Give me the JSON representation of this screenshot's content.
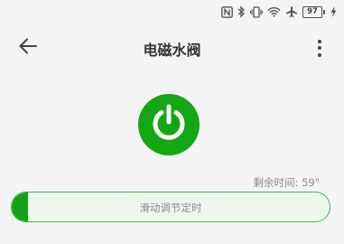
{
  "status_bar": {
    "battery_level": "97",
    "icons": [
      "nfc-icon",
      "bluetooth-icon",
      "vibrate-icon",
      "wifi-icon",
      "airplane-icon",
      "battery-icon",
      "charging-icon"
    ]
  },
  "app_bar": {
    "title": "电磁水阀",
    "back_icon": "arrow-left-icon",
    "more_icon": "more-vertical-icon"
  },
  "power": {
    "icon": "power-icon",
    "state": "on",
    "color": "#14a714"
  },
  "timer": {
    "remaining_text": "剩余时间: 59\""
  },
  "slider": {
    "label": "滑动调节定时",
    "fill_fraction": 0.05,
    "accent_color": "#4caf50"
  }
}
